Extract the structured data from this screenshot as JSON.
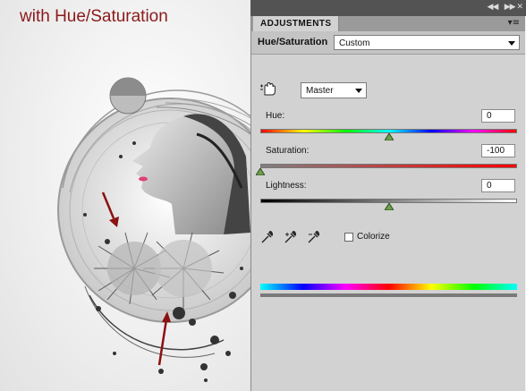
{
  "caption": "with Hue/Saturation",
  "panel": {
    "tab_label": "ADJUSTMENTS",
    "title": "Hue/Saturation",
    "preset": "Custom",
    "channel": "Master",
    "hue": {
      "label": "Hue:",
      "value": "0",
      "level": 0.5
    },
    "saturation": {
      "label": "Saturation:",
      "value": "-100",
      "level": 0.0
    },
    "lightness": {
      "label": "Lightness:",
      "value": "0",
      "level": 0.5
    },
    "colorize": {
      "label": "Colorize",
      "checked": false
    }
  },
  "colors": {
    "caption": "#8b1a1a",
    "panel_bg": "#d2d2d2",
    "arrow": "#8b1010"
  },
  "icons": [
    "targeted-adjustment-hand-icon",
    "eyedropper-icon",
    "eyedropper-plus-icon",
    "eyedropper-minus-icon",
    "panel-menu-icon",
    "collapse-arrows-icon"
  ]
}
